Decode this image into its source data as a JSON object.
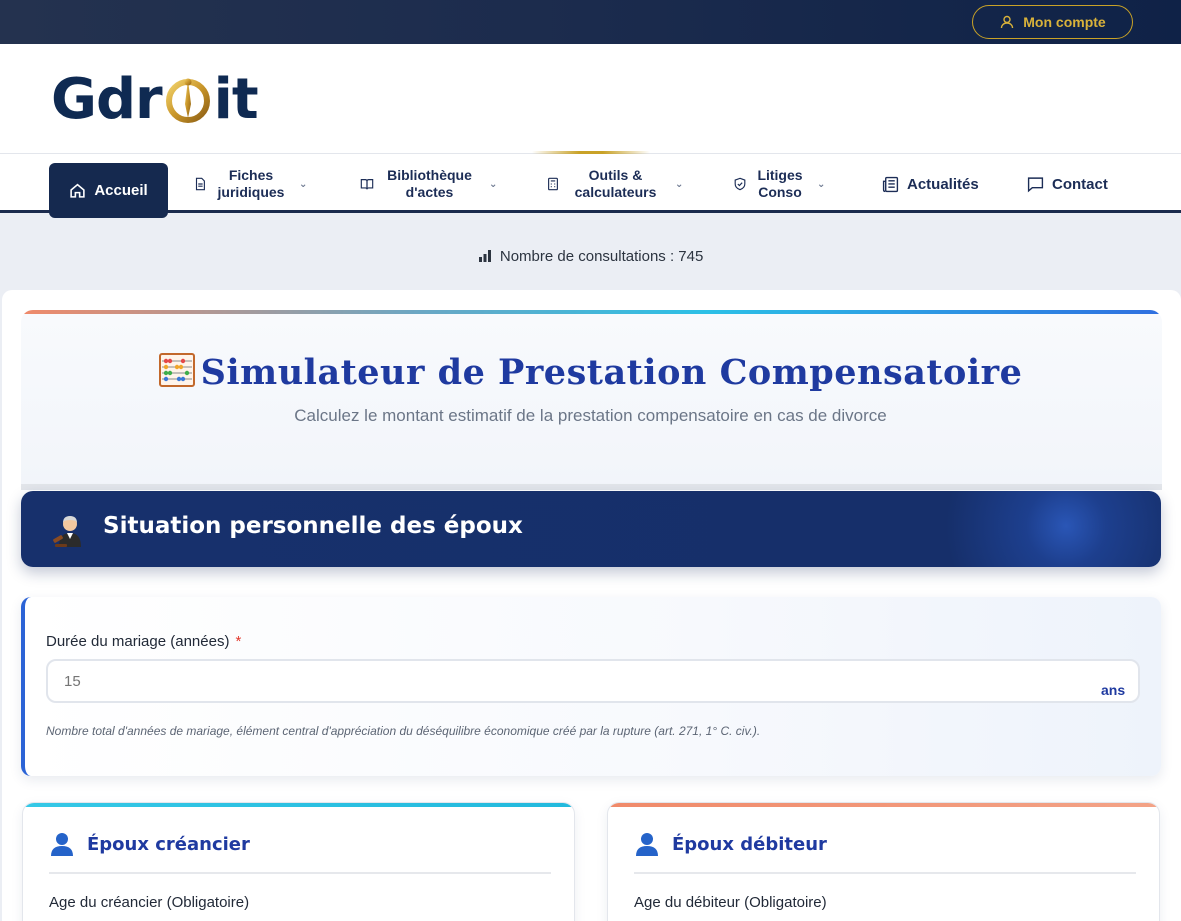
{
  "topbar": {
    "account_label": "Mon compte"
  },
  "logo": {
    "text_left": "Gdr",
    "text_right": "it"
  },
  "nav": {
    "items": [
      {
        "label": "Accueil",
        "icon": "home-icon",
        "active": true
      },
      {
        "label": "Fiches juridiques",
        "icon": "document-icon",
        "has_dropdown": true
      },
      {
        "label": "Bibliothèque d'actes",
        "icon": "book-icon",
        "has_dropdown": true
      },
      {
        "label": "Outils & calculateurs",
        "icon": "calculator-icon",
        "has_dropdown": true
      },
      {
        "label": "Litiges Conso",
        "icon": "shield-icon",
        "has_dropdown": true
      },
      {
        "label": "Actualités",
        "icon": "newspaper-icon"
      },
      {
        "label": "Contact",
        "icon": "chat-icon"
      }
    ]
  },
  "stats": {
    "consultations": "Nombre de consultations : 745"
  },
  "simulator": {
    "title": "Simulateur de Prestation Compensatoire",
    "subtitle": "Calculez le montant estimatif de la prestation compensatoire en cas de divorce"
  },
  "section": {
    "title": "Situation personnelle des époux"
  },
  "marriage_field": {
    "label": "Durée du mariage (années)",
    "required_mark": "*",
    "placeholder": "15",
    "value": "",
    "unit": "ans",
    "help": "Nombre total d'années de mariage, élément central d'appréciation du déséquilibre économique créé par la rupture (art. 271, 1° C. civ.)."
  },
  "creditor": {
    "title": "Époux créancier",
    "age_label": "Age du créancier (Obligatoire)"
  },
  "debtor": {
    "title": "Époux débiteur",
    "age_label": "Age du débiteur (Obligatoire)"
  },
  "colors": {
    "brand_navy": "#15294f",
    "gold": "#c9a227",
    "accent_blue": "#1f3aa0",
    "required": "#e23b2e"
  }
}
